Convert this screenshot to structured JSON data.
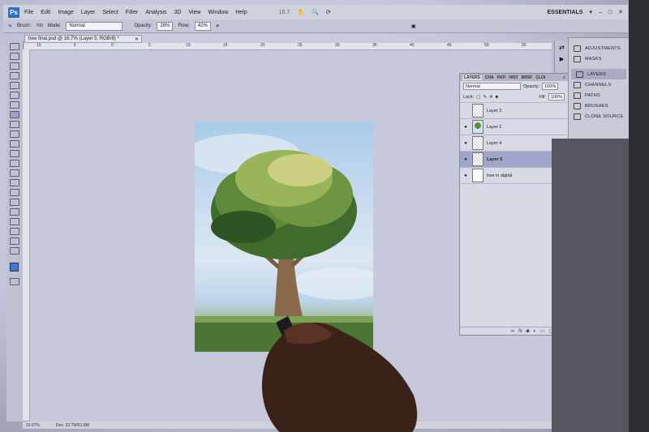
{
  "app": {
    "logo": "Ps",
    "workspace": "ESSENTIALS",
    "zoom_menu": "16.7",
    "menu": [
      "File",
      "Edit",
      "Image",
      "Layer",
      "Select",
      "Filter",
      "Analysis",
      "3D",
      "View",
      "Window",
      "Help"
    ]
  },
  "options_bar": {
    "brush_label": "Brush:",
    "brush_size": "700",
    "mode_label": "Mode:",
    "mode_value": "Normal",
    "opacity_label": "Opacity:",
    "opacity_value": "28%",
    "flow_label": "Flow:",
    "flow_value": "42%"
  },
  "document": {
    "tab_title": "tree final.psd @ 16.7% (Layer 5, RGB/8) *",
    "ruler_ticks": [
      "10",
      "5",
      "0",
      "5",
      "10",
      "15",
      "20",
      "25",
      "30",
      "35",
      "40",
      "45",
      "50",
      "55"
    ],
    "status_zoom": "16.67%",
    "status_doc": "Doc: 22.7M/51.8M"
  },
  "layers_panel": {
    "tabs": [
      "LAYERS",
      "CHA",
      "PATI",
      "HIST",
      "BRSF",
      "CLOI"
    ],
    "blend_mode": "Normal",
    "opacity_label": "Opacity:",
    "opacity_value": "100%",
    "lock_label": "Lock:",
    "fill_label": "Fill:",
    "fill_value": "100%",
    "layers": [
      {
        "name": "Layer 3",
        "visible": false,
        "thumb": "transparent",
        "selected": false
      },
      {
        "name": "Layer 2",
        "visible": true,
        "thumb": "tree",
        "selected": false
      },
      {
        "name": "Layer 4",
        "visible": true,
        "thumb": "transparent",
        "selected": false
      },
      {
        "name": "Layer 5",
        "visible": true,
        "thumb": "transparent",
        "selected": true
      },
      {
        "name": "tree in digital",
        "visible": true,
        "thumb": "white",
        "selected": false
      }
    ],
    "bottom_icons": [
      "link-icon",
      "fx-icon",
      "mask-icon",
      "adjustment-icon",
      "group-icon",
      "new-layer-icon",
      "trash-icon"
    ]
  },
  "dock": {
    "items": [
      {
        "label": "ADJUSTMENTS",
        "icon": "adjustments-icon",
        "active": false
      },
      {
        "label": "MASKS",
        "icon": "masks-icon",
        "active": false
      },
      {
        "label": "LAYERS",
        "icon": "layers-icon",
        "active": true
      },
      {
        "label": "CHANNELS",
        "icon": "channels-icon",
        "active": false
      },
      {
        "label": "PATHS",
        "icon": "paths-icon",
        "active": false
      },
      {
        "label": "BRUSHES",
        "icon": "brushes-icon",
        "active": false
      },
      {
        "label": "CLONE SOURCE",
        "icon": "clone-source-icon",
        "active": false
      }
    ]
  },
  "colors": {
    "foreground": "#3a7bd5",
    "selected_layer": "#9fa6c9",
    "app_logo": "#2d6ec6"
  }
}
